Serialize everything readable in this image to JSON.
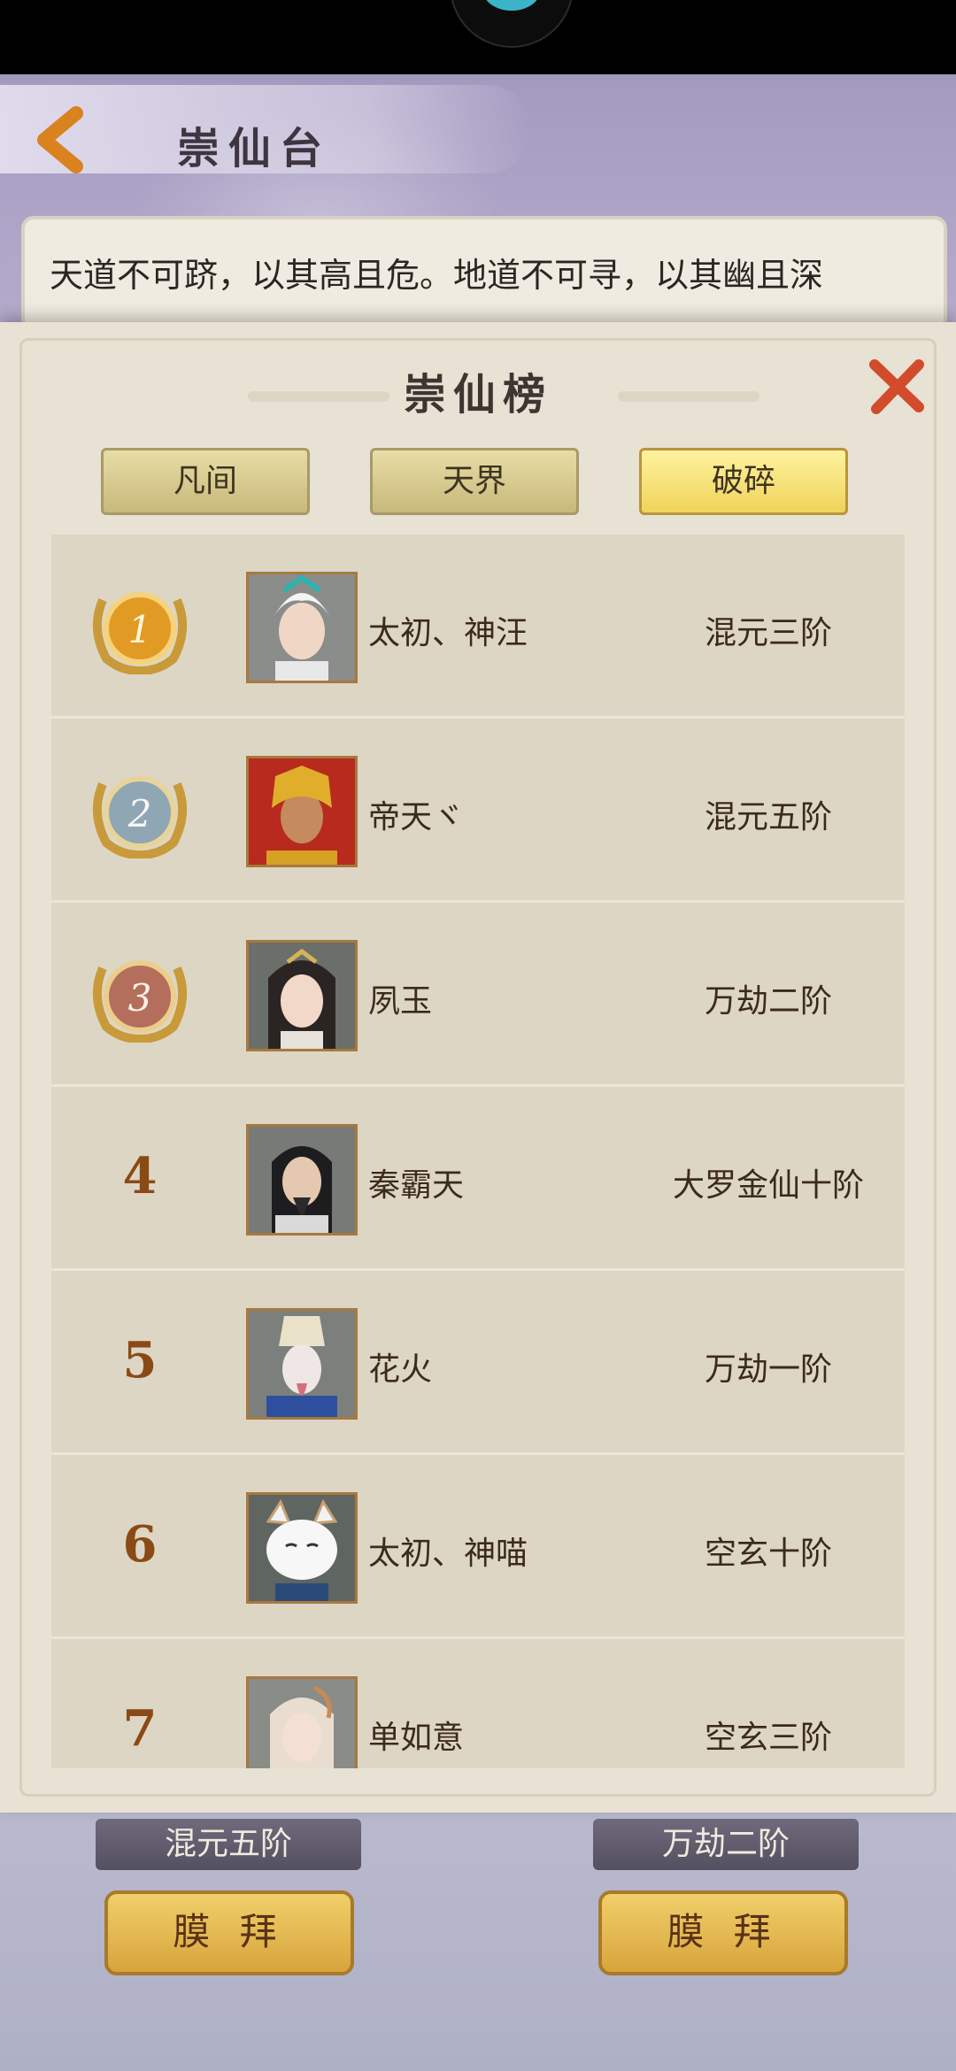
{
  "header": {
    "title": "崇仙台"
  },
  "intro": {
    "text": "天道不可跻，以其高且危。地道不可寻，以其幽且深"
  },
  "modal": {
    "title": "崇仙榜",
    "tabs": [
      {
        "label": "凡间",
        "active": false
      },
      {
        "label": "天界",
        "active": false
      },
      {
        "label": "破碎",
        "active": true
      }
    ]
  },
  "ranking": [
    {
      "rank": "1",
      "name": "太初、神汪",
      "realm": "混元三阶",
      "medal": "gold"
    },
    {
      "rank": "2",
      "name": "帝天ヾ",
      "realm": "混元五阶",
      "medal": "silver"
    },
    {
      "rank": "3",
      "name": "夙玉",
      "realm": "万劫二阶",
      "medal": "bronze"
    },
    {
      "rank": "4",
      "name": "秦霸天",
      "realm": "大罗金仙十阶"
    },
    {
      "rank": "5",
      "name": "花火",
      "realm": "万劫一阶"
    },
    {
      "rank": "6",
      "name": "太初、神喵",
      "realm": "空玄十阶"
    },
    {
      "rank": "7",
      "name": "单如意",
      "realm": "空玄三阶"
    }
  ],
  "bottom": {
    "left_realm": "混元五阶",
    "right_realm": "万劫二阶",
    "worship_label": "膜 拜"
  },
  "colors": {
    "tab_active": "#efd45a",
    "accent_gold": "#d8a43c",
    "close_red": "#d24b2c"
  }
}
